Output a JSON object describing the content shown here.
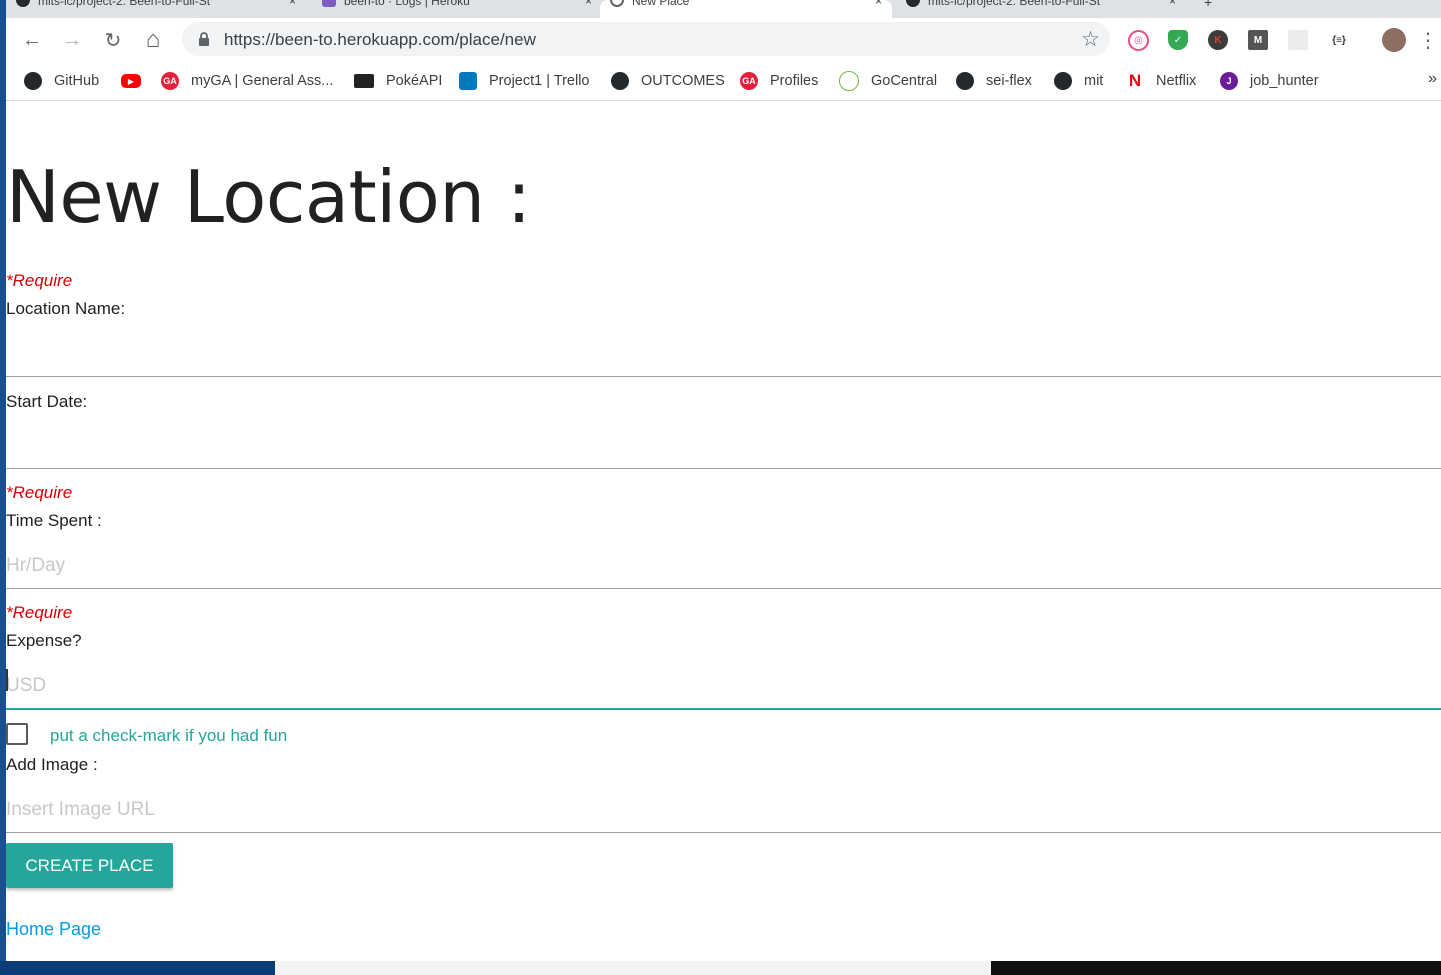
{
  "tabs": [
    {
      "title": "mits-lc/project-2: Been-to-Full-St",
      "active": false
    },
    {
      "title": "been-to · Logs | Heroku",
      "active": false
    },
    {
      "title": "New Place",
      "active": true
    },
    {
      "title": "mits-lc/project-2: Been-to-Full-St",
      "active": false
    }
  ],
  "tab_close_glyph": "×",
  "new_tab_glyph": "+",
  "toolbar": {
    "url": "https://been-to.herokuapp.com/place/new",
    "back_icon": "←",
    "forward_icon": "→",
    "reload_icon": "↻",
    "home_icon": "⌂",
    "star_icon": "☆",
    "menu_icon": "⋮"
  },
  "extensions": [
    {
      "name": "dribbble-icon",
      "color": "#ea4c89",
      "glyph": "◎"
    },
    {
      "name": "adblock-shield-icon",
      "color": "#34a853",
      "glyph": "✓"
    },
    {
      "name": "k-extension-icon",
      "color": "#3c3c3c",
      "glyph": "K"
    },
    {
      "name": "m-extension-icon",
      "color": "#555555",
      "glyph": "M"
    },
    {
      "name": "grid-extension-icon",
      "color": "#e6e6e6",
      "glyph": ""
    },
    {
      "name": "json-extension-icon",
      "color": "#ffffff",
      "glyph": "{≡}"
    },
    {
      "name": "profile-avatar-icon",
      "color": "#8d6e63",
      "glyph": ""
    }
  ],
  "bookmarks": [
    {
      "label": "GitHub",
      "icon": "github-icon",
      "color": "#24292e",
      "glyph": ""
    },
    {
      "label": "",
      "icon": "youtube-icon",
      "color": "#ff0000",
      "glyph": "▶"
    },
    {
      "label": "myGA | General Ass...",
      "icon": "ga-icon",
      "color": "#e5203a",
      "glyph": "GA"
    },
    {
      "label": "PokéAPI",
      "icon": "pokeapi-icon",
      "color": "#222222",
      "glyph": ""
    },
    {
      "label": "Project1 | Trello",
      "icon": "trello-icon",
      "color": "#0079bf",
      "glyph": ""
    },
    {
      "label": "OUTCOMES",
      "icon": "github-icon",
      "color": "#24292e",
      "glyph": ""
    },
    {
      "label": "Profiles",
      "icon": "ga-icon",
      "color": "#e5203a",
      "glyph": "GA"
    },
    {
      "label": "GoCentral",
      "icon": "gocentral-icon",
      "color": "#7cb342",
      "glyph": ""
    },
    {
      "label": "sei-flex",
      "icon": "github-icon",
      "color": "#24292e",
      "glyph": ""
    },
    {
      "label": "mit",
      "icon": "github-icon",
      "color": "#24292e",
      "glyph": ""
    },
    {
      "label": "Netflix",
      "icon": "netflix-icon",
      "color": "#e50914",
      "glyph": "N"
    },
    {
      "label": "job_hunter",
      "icon": "job-hunter-icon",
      "color": "#6a1b9a",
      "glyph": "J"
    }
  ],
  "bookmarks_more": "»",
  "page": {
    "title": "New Location :",
    "require_text": "*Require",
    "location_label": "Location Name:",
    "start_date_label": "Start Date:",
    "time_spent_label": "Time Spent :",
    "time_spent_placeholder": "Hr/Day",
    "expense_label": "Expense?",
    "expense_placeholder": "USD",
    "fun_label": "put a check-mark if you had fun",
    "add_image_label": "Add Image :",
    "image_placeholder": "Insert Image URL",
    "create_button": "CREATE PLACE",
    "home_link": "Home Page"
  },
  "colors": {
    "accent": "#26a69a",
    "require": "#d50000",
    "link": "#039be5"
  }
}
